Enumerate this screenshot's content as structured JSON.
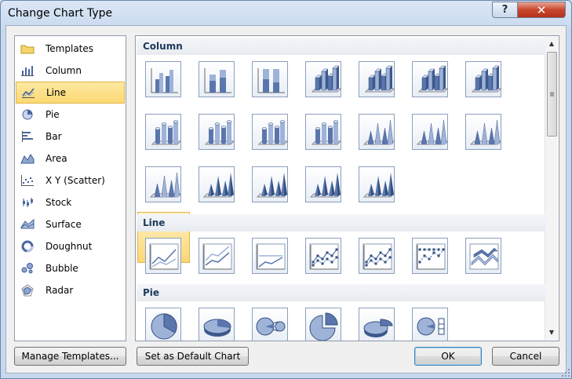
{
  "window": {
    "title": "Change Chart Type",
    "help_label": "?",
    "close_label": "✕"
  },
  "chart_types": [
    {
      "label": "Templates",
      "icon": "folder-icon",
      "selected": false
    },
    {
      "label": "Column",
      "icon": "column-chart-icon",
      "selected": false
    },
    {
      "label": "Line",
      "icon": "line-chart-icon",
      "selected": true
    },
    {
      "label": "Pie",
      "icon": "pie-chart-icon",
      "selected": false
    },
    {
      "label": "Bar",
      "icon": "bar-chart-icon",
      "selected": false
    },
    {
      "label": "Area",
      "icon": "area-chart-icon",
      "selected": false
    },
    {
      "label": "X Y (Scatter)",
      "icon": "scatter-chart-icon",
      "selected": false
    },
    {
      "label": "Stock",
      "icon": "stock-chart-icon",
      "selected": false
    },
    {
      "label": "Surface",
      "icon": "surface-chart-icon",
      "selected": false
    },
    {
      "label": "Doughnut",
      "icon": "doughnut-chart-icon",
      "selected": false
    },
    {
      "label": "Bubble",
      "icon": "bubble-chart-icon",
      "selected": false
    },
    {
      "label": "Radar",
      "icon": "radar-chart-icon",
      "selected": false
    }
  ],
  "gallery": {
    "sections": [
      {
        "label": "Column",
        "thumbs": [
          "clustered-column-icon",
          "stacked-column-icon",
          "100-stacked-column-icon",
          "3d-clustered-column-icon",
          "3d-stacked-column-icon",
          "3d-100-stacked-column-icon",
          "3d-column-icon",
          "clustered-cylinder-icon",
          "stacked-cylinder-icon",
          "100-stacked-cylinder-icon",
          "3d-cylinder-icon",
          "clustered-cone-icon",
          "stacked-cone-icon",
          "100-stacked-cone-icon",
          "3d-cone-icon",
          "clustered-pyramid-icon",
          "stacked-pyramid-icon",
          "100-stacked-pyramid-icon",
          "3d-pyramid-icon"
        ]
      },
      {
        "label": "Line",
        "thumbs": [
          "line-icon",
          "stacked-line-icon",
          "100-stacked-line-icon",
          "line-markers-icon",
          "stacked-line-markers-icon",
          "100-stacked-line-markers-icon",
          "3d-line-icon"
        ]
      },
      {
        "label": "Pie",
        "thumbs": [
          "pie-icon",
          "3d-pie-icon",
          "pie-of-pie-icon",
          "exploded-pie-icon",
          "exploded-3d-pie-icon",
          "bar-of-pie-icon"
        ]
      }
    ],
    "selected_thumb": "line-icon"
  },
  "buttons": {
    "manage_templates": "Manage Templates...",
    "set_default": "Set as Default Chart",
    "ok": "OK",
    "cancel": "Cancel"
  },
  "colors": {
    "accent": "#5470a8",
    "selection": "#fbd871",
    "section_header": "#1e395b"
  }
}
